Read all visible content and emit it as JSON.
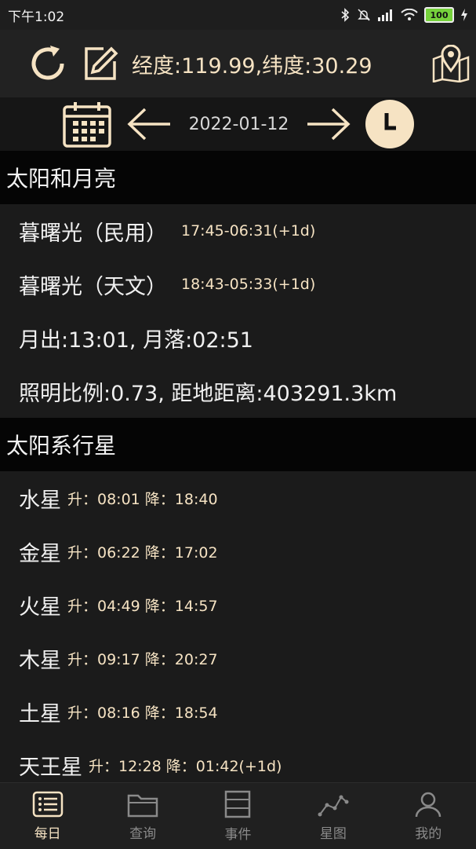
{
  "status": {
    "time": "下午1:02",
    "battery": "100"
  },
  "toolbar": {
    "coords": "经度:119.99,纬度:30.29"
  },
  "datebar": {
    "date": "2022-01-12"
  },
  "sections": {
    "sun_moon": "太阳和月亮",
    "planets": "太阳系行星"
  },
  "sun_moon": {
    "civil_label": "暮曙光（民用）",
    "civil_value": "17:45-06:31(+1d)",
    "astro_label": "暮曙光（天文）",
    "astro_value": "18:43-05:33(+1d)",
    "moon_rise_set": "月出:13:01, 月落:02:51",
    "illumination": "照明比例:0.73, 距地距离:403291.3km"
  },
  "planets": [
    {
      "name": "水星",
      "times": "升：08:01 降：18:40"
    },
    {
      "name": "金星",
      "times": "升：06:22 降：17:02"
    },
    {
      "name": "火星",
      "times": "升：04:49 降：14:57"
    },
    {
      "name": "木星",
      "times": "升：09:17 降：20:27"
    },
    {
      "name": "土星",
      "times": "升：08:16 降：18:54"
    },
    {
      "name": "天王星",
      "times": "升：12:28 降：01:42(+1d)"
    }
  ],
  "nav": [
    {
      "label": "每日"
    },
    {
      "label": "查询"
    },
    {
      "label": "事件"
    },
    {
      "label": "星图"
    },
    {
      "label": "我的"
    }
  ],
  "colors": {
    "accent": "#f6e3c3",
    "background": "#1b1b1b",
    "section": "#050505"
  }
}
